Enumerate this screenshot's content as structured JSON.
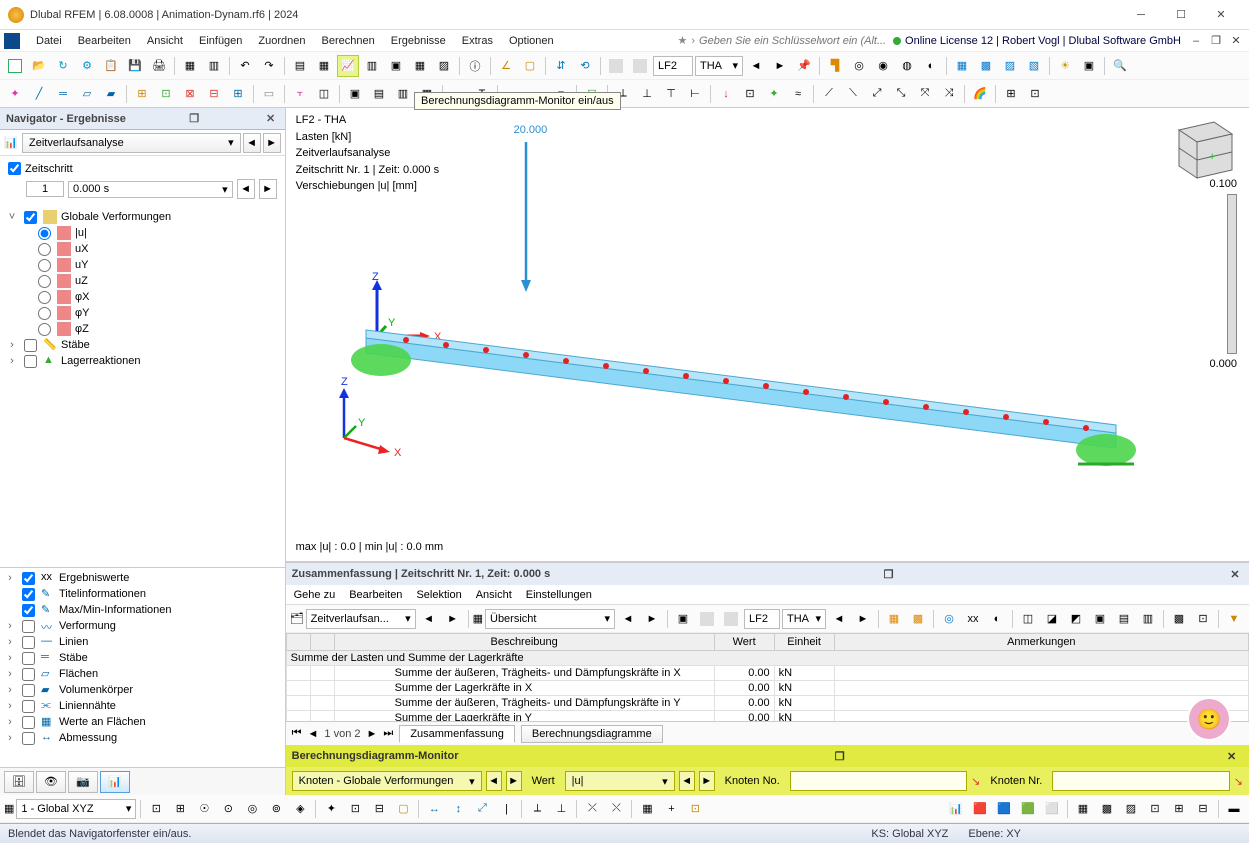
{
  "titlebar": {
    "title": "Dlubal RFEM | 6.08.0008 | Animation-Dynam.rf6 | 2024"
  },
  "menubar": {
    "items": [
      "Datei",
      "Bearbeiten",
      "Ansicht",
      "Einfügen",
      "Zuordnen",
      "Berechnen",
      "Ergebnisse",
      "Extras",
      "Optionen"
    ],
    "search_placeholder": "Geben Sie ein Schlüsselwort ein (Alt...",
    "license": "Online License 12 | Robert Vogl | Dlubal Software GmbH"
  },
  "tooltip": "Berechnungsdiagramm-Monitor ein/aus",
  "toolbar1": {
    "loadcase": "LF2",
    "loadtype": "THA"
  },
  "nav": {
    "title": "Navigator - Ergebnisse",
    "analysis": "Zeitverlaufsanalyse",
    "time_label": "Zeitschritt",
    "time_step": "1",
    "time_val": "0.000 s",
    "tree_root": "Globale Verformungen",
    "tree_items": [
      "|u|",
      "uX",
      "uY",
      "uZ",
      "φX",
      "φY",
      "φZ"
    ],
    "tree_more": [
      "Stäbe",
      "Lagerreaktionen"
    ],
    "lower_items": [
      "Ergebniswerte",
      "Titelinformationen",
      "Max/Min-Informationen",
      "Verformung",
      "Linien",
      "Stäbe",
      "Flächen",
      "Volumenkörper",
      "Liniennähte",
      "Werte an Flächen",
      "Abmessung"
    ]
  },
  "view3d": {
    "legend": [
      "LF2 - THA",
      "Lasten [kN]",
      "Zeitverlaufsanalyse",
      "Zeitschritt Nr. 1 | Zeit: 0.000 s",
      "Verschiebungen |u| [mm]"
    ],
    "load_value": "20.000",
    "cbar_top": "0.100",
    "cbar_bot": "0.000",
    "minmax": "max |u| : 0.0 | min |u| : 0.0 mm"
  },
  "summary": {
    "title": "Zusammenfassung | Zeitschritt Nr. 1, Zeit: 0.000 s",
    "menu": [
      "Gehe zu",
      "Bearbeiten",
      "Selektion",
      "Ansicht",
      "Einstellungen"
    ],
    "tb_combo": "Zeitverlaufsan...",
    "tb_view": "Übersicht",
    "tb_lc": "LF2",
    "tb_lt": "THA",
    "cols": [
      "Beschreibung",
      "Wert",
      "Einheit",
      "Anmerkungen"
    ],
    "group": "Summe der Lasten und Summe der Lagerkräfte",
    "rows": [
      {
        "d": "Summe der äußeren, Trägheits- und Dämpfungskräfte in X",
        "w": "0.00",
        "e": "kN"
      },
      {
        "d": "Summe der Lagerkräfte in X",
        "w": "0.00",
        "e": "kN"
      },
      {
        "d": "Summe der äußeren, Trägheits- und Dämpfungskräfte in Y",
        "w": "0.00",
        "e": "kN"
      },
      {
        "d": "Summe der Lagerkräfte in Y",
        "w": "0.00",
        "e": "kN"
      }
    ],
    "pager": "1 von 2",
    "tabs": [
      "Zusammenfassung",
      "Berechnungsdiagramme"
    ]
  },
  "monitor": {
    "title": "Berechnungsdiagramm-Monitor",
    "combo1": "Knoten - Globale Verformungen",
    "wert": "Wert",
    "u": "|u|",
    "knoten": "Knoten No.",
    "knoten_nr": "Knoten Nr."
  },
  "statusbar": {
    "cs_label": "1 - Global XYZ",
    "hint": "Blendet das Navigatorfenster ein/aus.",
    "ks": "KS: Global XYZ",
    "ebene": "Ebene: XY"
  }
}
